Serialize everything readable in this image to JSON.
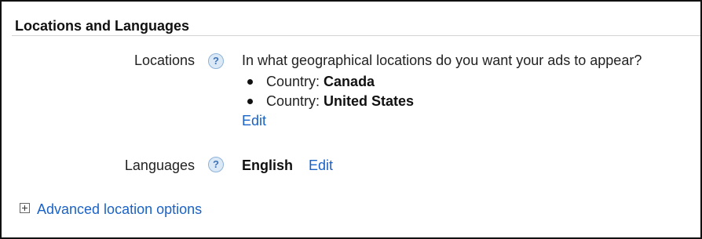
{
  "section": {
    "title": "Locations and Languages"
  },
  "locations": {
    "label": "Locations",
    "help_icon": "question-mark-help-icon",
    "question": "In what geographical locations do you want your ads to appear?",
    "items": [
      {
        "prefix": "Country:",
        "name": "Canada"
      },
      {
        "prefix": "Country:",
        "name": "United States"
      }
    ],
    "edit_label": "Edit"
  },
  "languages": {
    "label": "Languages",
    "help_icon": "question-mark-help-icon",
    "value": "English",
    "edit_label": "Edit"
  },
  "advanced": {
    "icon": "expand-plus-icon",
    "label": "Advanced location options"
  },
  "colors": {
    "link": "#1a62c6",
    "help_icon_bg": "#dbe9f7",
    "divider": "#d3d3d3"
  }
}
